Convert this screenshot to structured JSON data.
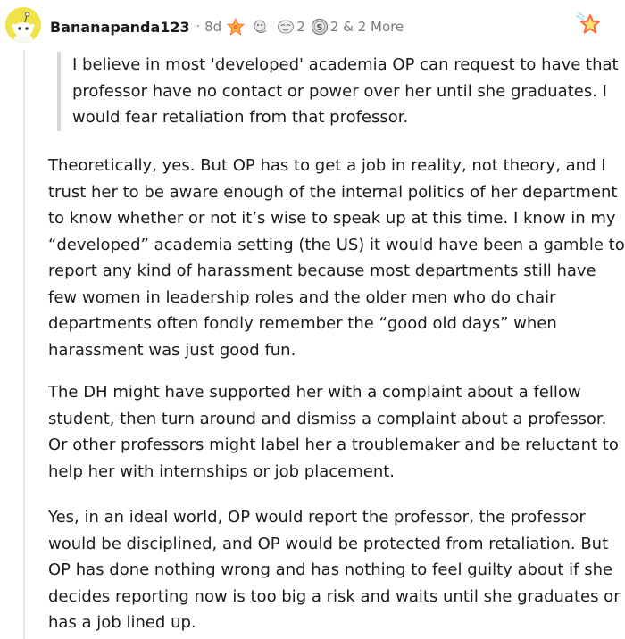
{
  "comment": {
    "username": "Bananapanda123",
    "separator": "·",
    "age": "8d",
    "awards": [
      {
        "icon": "star-award-icon",
        "count": ""
      },
      {
        "icon": "wholesome-award-icon",
        "count": ""
      },
      {
        "icon": "face-award-icon",
        "count": "2"
      },
      {
        "icon": "silver-coin-award-icon",
        "count": "2"
      }
    ],
    "more_awards": "& 2 More",
    "quote": "I believe in most 'developed' academia OP can request to have that professor have no contact or power over her until she graduates. I would fear retaliation from that professor.",
    "paragraphs": [
      "Theoretically, yes. But OP has to get a job in reality, not theory, and I trust her to be aware enough of the internal politics of her department to know whether or not it’s wise to speak up at this time. I know in my “developed” academia setting (the US) it would have been a gamble to report any kind of harassment because most departments still have few women in leadership roles and the older men who do chair departments often fondly remember the “good old days” when harassment was just good fun.",
      "The DH might have supported her with a complaint about a fellow student, then turn around and dismiss a complaint about a professor. Or other professors might label her a troublemaker and be reluctant to help her with internships or job placement.",
      "Yes, in an ideal world, OP would report the professor, the professor would be disciplined, and OP would be protected from retaliation. But OP has done nothing wrong and has nothing to feel guilty about if she decides reporting now is too big a risk and waits until she graduates or has a job lined up."
    ]
  },
  "colors": {
    "avatar_bg": "#f2e24a",
    "meta_text": "#7c7c7c",
    "quote_bar": "#d8d8d8",
    "award_gold": "#f5b82e",
    "award_orange": "#ff6b3d"
  }
}
